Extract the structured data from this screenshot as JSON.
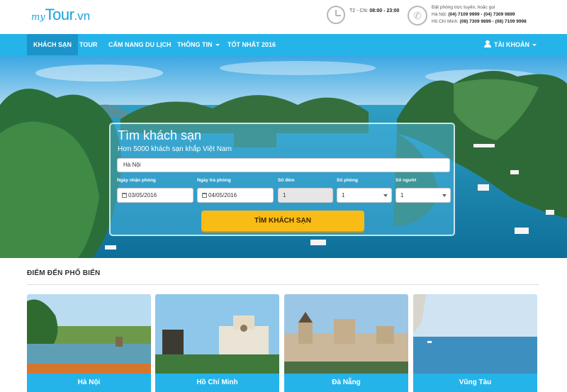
{
  "brand": {
    "logo_my": "my",
    "logo_tour": "Tour",
    "logo_vn": ".vn"
  },
  "header": {
    "hours_label": "T2 - CN:",
    "hours_value": "08:00 - 23:00",
    "phone_intro": "Đặt phòng trực tuyến, hoặc gọi",
    "hanoi_label": "Hà Nội:",
    "hanoi_phones": "(04) 7109 9999 - (04) 7309 9899",
    "hcm_label": "Hồ Chí Minh:",
    "hcm_phones": "(08) 7309 9899 - (08) 7109 9998"
  },
  "nav": {
    "items": [
      {
        "label": "KHÁCH SẠN",
        "active": true
      },
      {
        "label": "TOUR"
      },
      {
        "label": "CẨM NANG DU LỊCH"
      },
      {
        "label": "THÔNG TIN",
        "dropdown": true
      },
      {
        "label": "TỐT NHẤT 2016"
      }
    ],
    "account_label": "TÀI KHOẢN"
  },
  "search": {
    "title": "Tìm khách sạn",
    "subtitle": "Hơn 5000 khách sạn khắp Việt Nam",
    "destination_value": "Hà Nội",
    "checkin_label": "Ngày nhận phòng",
    "checkin_value": "03/05/2016",
    "checkout_label": "Ngày trả phòng",
    "checkout_value": "04/05/2016",
    "nights_label": "Số đêm",
    "nights_value": "1",
    "rooms_label": "Số phòng",
    "rooms_value": "1",
    "guests_label": "Số người",
    "guests_value": "1",
    "button_label": "TÌM KHÁCH SẠN"
  },
  "popular": {
    "title": "ĐIỂM ĐẾN PHỔ BIẾN",
    "destinations": [
      {
        "name": "Hà Nội"
      },
      {
        "name": "Hồ Chí Minh"
      },
      {
        "name": "Đà Nẵng"
      },
      {
        "name": "Vũng Tàu"
      }
    ]
  },
  "colors": {
    "primary": "#25b4e9",
    "nav_active": "#1b95c9",
    "button": "#f9bb15"
  }
}
